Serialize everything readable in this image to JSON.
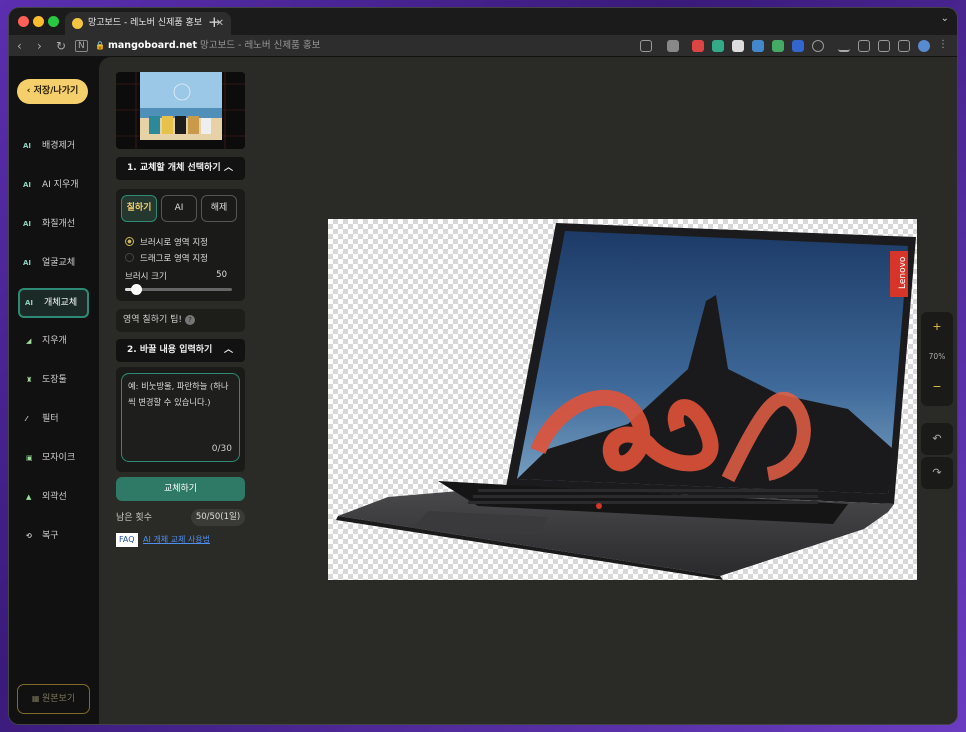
{
  "browser": {
    "tab_title": "망고보드 - 레노버 신제품 홍보",
    "url_domain": "mangoboard.net",
    "url_title": "망고보드 - 레노버 신제품 홍보"
  },
  "sidebar": {
    "back_label": "저장/나가기",
    "items": [
      {
        "label": "배경제거",
        "icon": "ai-icon"
      },
      {
        "label": "AI 지우개",
        "icon": "ai-icon"
      },
      {
        "label": "화질개선",
        "icon": "ai-icon"
      },
      {
        "label": "얼굴교체",
        "icon": "ai-icon"
      },
      {
        "label": "개체교체",
        "icon": "ai-icon"
      },
      {
        "label": "지우개",
        "icon": "eraser-icon"
      },
      {
        "label": "도장툴",
        "icon": "stamp-icon"
      },
      {
        "label": "필터",
        "icon": "filter-icon"
      },
      {
        "label": "모자이크",
        "icon": "mosaic-icon"
      },
      {
        "label": "외곽선",
        "icon": "outline-icon"
      },
      {
        "label": "복구",
        "icon": "restore-icon"
      }
    ],
    "original_view_label": "원본보기"
  },
  "panel": {
    "section1_title": "1. 교체할 개체 선택하기",
    "modes": [
      "칠하기",
      "AI",
      "해제"
    ],
    "radio_brush": "브러시로 영역 지정",
    "radio_drag": "드래그로 영역 지정",
    "brush_size_label": "브러시 크기",
    "brush_size_value": "50",
    "brush_size_fraction": 0.1,
    "tip_label": "영역 칠하기 팁!",
    "section2_title": "2. 바꿀 내용 입력하기",
    "textarea_placeholder": "예: 비눗방울, 파란하늘 (하나씩 변경할 수 있습니다.)",
    "char_count": "0/30",
    "replace_button": "교체하기",
    "remaining_label": "남은 횟수",
    "remaining_value": "50/50(1일)",
    "faq_badge": "FAQ",
    "faq_link": "AI 개체 교체 사용법"
  },
  "canvas": {
    "zoom_in": "+",
    "zoom_value": "70%",
    "zoom_out": "−",
    "laptop_brand": "Lenovo"
  },
  "colors": {
    "accent": "#2e8a74",
    "highlight": "#f4cf6b",
    "panel_bg": "#2a2a26"
  }
}
